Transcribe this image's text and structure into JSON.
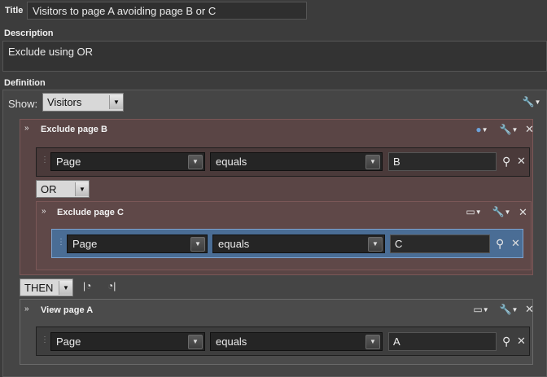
{
  "title": {
    "label": "Title",
    "value": "Visitors to page A avoiding page B or C"
  },
  "description": {
    "label": "Description",
    "value": "Exclude using OR"
  },
  "definition": {
    "label": "Definition",
    "show_label": "Show:",
    "show_value": "Visitors",
    "containers": [
      {
        "title": "Exclude page B",
        "rule": {
          "dimension": "Page",
          "operator": "equals",
          "value": "B"
        }
      },
      {
        "title": "Exclude page C",
        "rule": {
          "dimension": "Page",
          "operator": "equals",
          "value": "C"
        }
      },
      {
        "title": "View page A",
        "rule": {
          "dimension": "Page",
          "operator": "equals",
          "value": "A"
        }
      }
    ],
    "or_operator": "OR",
    "then_operator": "THEN"
  },
  "icons": {
    "wrench": "wrench-icon",
    "close": "close-icon",
    "search": "search-icon",
    "segment": "segment-icon",
    "container": "container-icon",
    "time_before": "time-constraint-before-icon",
    "time_after": "time-constraint-after-icon"
  },
  "colors": {
    "exclude_bg": "#5c4444",
    "exclude_border": "#7d5b5b",
    "highlight_row": "#4a6d95",
    "panel": "#4a4a4a"
  }
}
